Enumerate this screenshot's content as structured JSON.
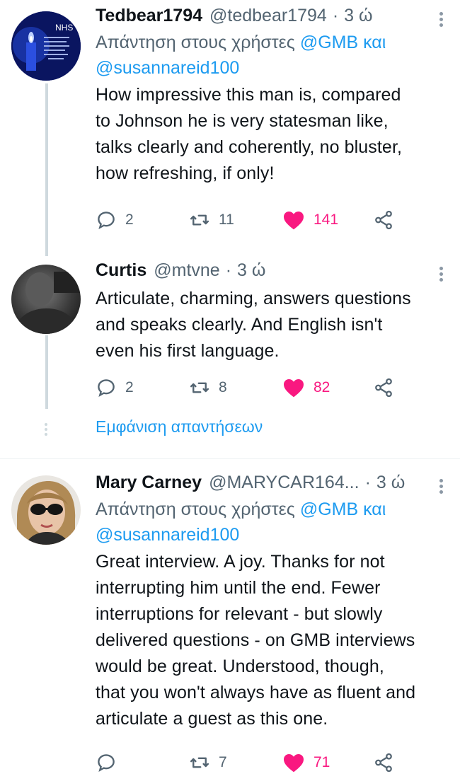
{
  "tweets": [
    {
      "name": "Tedbear1794",
      "handle": "@tedbear1794",
      "separator": "·",
      "time": "3 ώ",
      "replying_prefix": "Απάντηση στους χρήστες",
      "mention1": "@GMB",
      "conjunction": "και",
      "mention2": "@susannareid100",
      "text_lines": [
        "How impressive this man is, compared",
        "to Johnson he is very statesman like,",
        "talks clearly and coherently, no bluster,",
        "how refreshing, if only!"
      ],
      "avatar_text": "NHS",
      "replies": "2",
      "retweets": "11",
      "likes": "141"
    },
    {
      "name": "Curtis",
      "handle": "@mtvne",
      "separator": "·",
      "time": "3 ώ",
      "text_lines": [
        "Articulate, charming, answers questions",
        "and speaks clearly. And English isn't",
        "even his first language."
      ],
      "replies": "2",
      "retweets": "8",
      "likes": "82"
    },
    {
      "name": "Mary Carney",
      "handle": "@MARYCAR164...",
      "separator": "·",
      "time": "3 ώ",
      "replying_prefix": "Απάντηση στους χρήστες",
      "mention1": "@GMB",
      "conjunction": "και",
      "mention2": "@susannareid100",
      "text_lines": [
        "Great interview. A joy. Thanks for not",
        "interrupting him until the end. Fewer",
        "interruptions for relevant - but slowly",
        "delivered questions - on GMB interviews",
        "would be great. Understood, though,",
        "that you won't always have as fluent and",
        "articulate a guest as this one."
      ],
      "retweets": "7",
      "likes": "71"
    }
  ],
  "show_replies_label": "Εμφάνιση απαντήσεων",
  "icons": {
    "reply": "reply-icon",
    "retweet": "retweet-icon",
    "like": "heart-icon",
    "share": "share-icon",
    "more": "more-icon"
  },
  "colors": {
    "accent": "#1d9bf0",
    "like": "#f91880",
    "secondary_text": "#536471"
  }
}
